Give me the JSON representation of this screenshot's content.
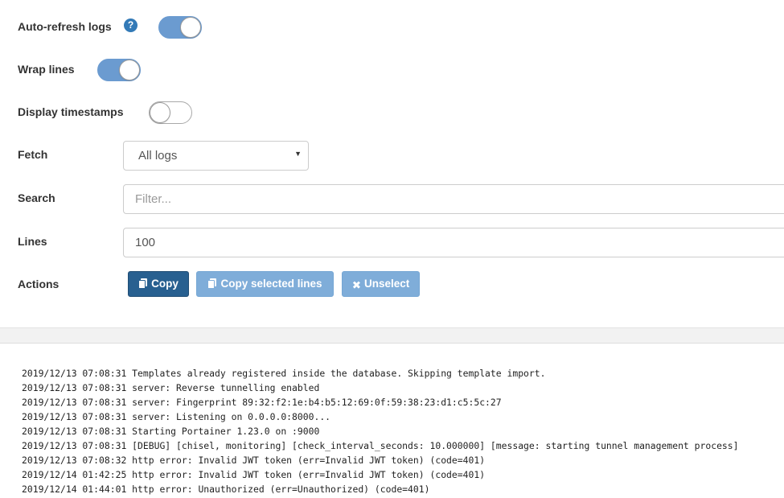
{
  "settings": {
    "auto_refresh": {
      "label": "Auto-refresh logs",
      "help_icon": "question-circle-icon",
      "enabled": true
    },
    "wrap_lines": {
      "label": "Wrap lines",
      "enabled": true
    },
    "display_timestamps": {
      "label": "Display timestamps",
      "enabled": false
    },
    "fetch": {
      "label": "Fetch",
      "selected": "All logs"
    },
    "search": {
      "label": "Search",
      "placeholder": "Filter..."
    },
    "lines": {
      "label": "Lines",
      "value": "100"
    },
    "actions": {
      "label": "Actions",
      "copy": "Copy",
      "copy_selected": "Copy selected lines",
      "unselect": "Unselect"
    }
  },
  "colors": {
    "toggle_on": "#6b9bd0",
    "primary_button": "#286090",
    "disabled_button": "#7fadd9",
    "help_icon": "#337ab7"
  },
  "logs": [
    "2019/12/13 07:08:31 Templates already registered inside the database. Skipping template import.",
    "2019/12/13 07:08:31 server: Reverse tunnelling enabled",
    "2019/12/13 07:08:31 server: Fingerprint 89:32:f2:1e:b4:b5:12:69:0f:59:38:23:d1:c5:5c:27",
    "2019/12/13 07:08:31 server: Listening on 0.0.0.0:8000...",
    "2019/12/13 07:08:31 Starting Portainer 1.23.0 on :9000",
    "2019/12/13 07:08:31 [DEBUG] [chisel, monitoring] [check_interval_seconds: 10.000000] [message: starting tunnel management process]",
    "2019/12/13 07:08:32 http error: Invalid JWT token (err=Invalid JWT token) (code=401)",
    "2019/12/14 01:42:25 http error: Invalid JWT token (err=Invalid JWT token) (code=401)",
    "2019/12/14 01:44:01 http error: Unauthorized (err=Unauthorized) (code=401)"
  ]
}
